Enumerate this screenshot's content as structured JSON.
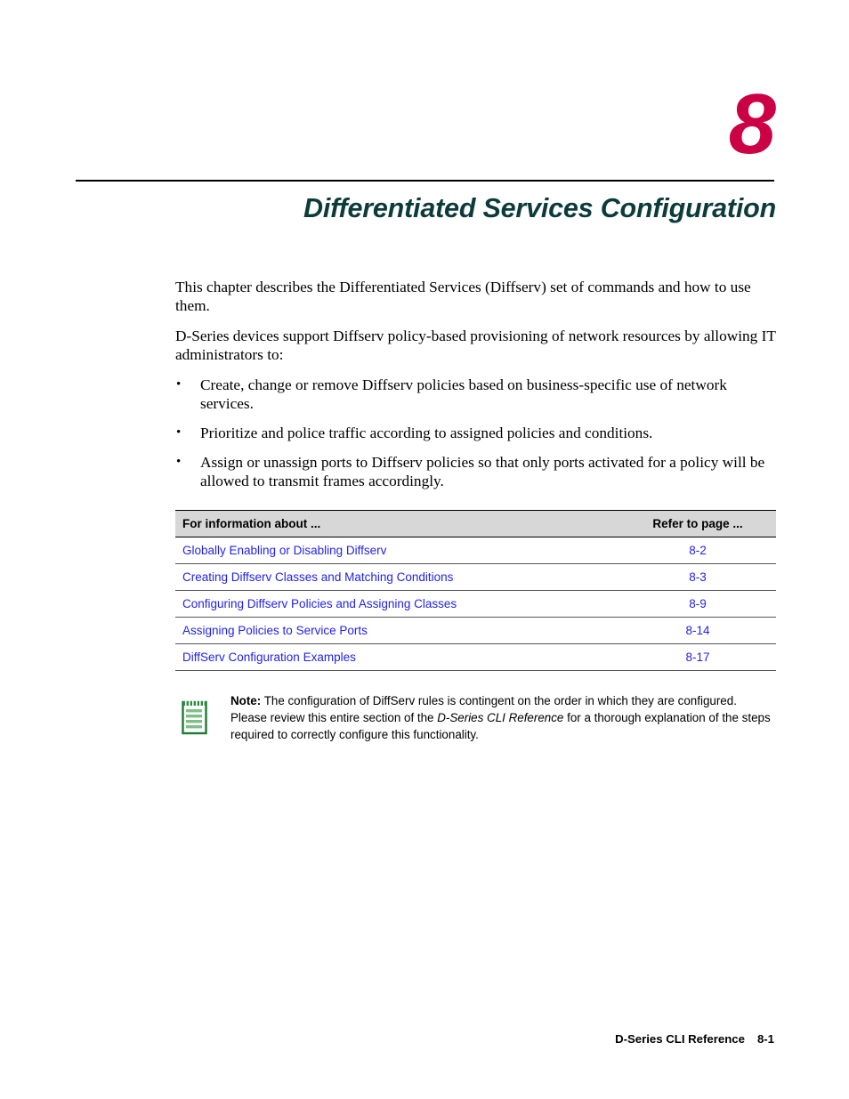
{
  "chapter": {
    "number": "8",
    "title": "Differentiated Services Configuration",
    "number_color": "#cc0044",
    "title_color": "#0d3b3b"
  },
  "intro": {
    "paragraph_1": "This chapter describes the Differentiated Services (Diffserv) set of commands and how to use them.",
    "paragraph_2": "D-Series devices support Diffserv policy-based provisioning of network resources by allowing IT administrators to:"
  },
  "bullets": [
    "Create, change or remove Diffserv policies based on business-specific use of network services.",
    "Prioritize and police traffic according to assigned policies and conditions.",
    "Assign or unassign ports to Diffserv policies so that only ports activated for a policy will be allowed to transmit frames accordingly."
  ],
  "ref_table": {
    "headers": [
      "For information about ...",
      "Refer to page ..."
    ],
    "link_color": "#2222ee",
    "header_bg": "#d7d7d7",
    "rows": [
      {
        "topic": "Globally Enabling or Disabling Diffserv",
        "page": "8-2"
      },
      {
        "topic": "Creating Diffserv Classes and Matching Conditions",
        "page": "8-3"
      },
      {
        "topic": "Configuring Diffserv Policies and Assigning Classes",
        "page": "8-9"
      },
      {
        "topic": "Assigning Policies to Service Ports",
        "page": "8-14"
      },
      {
        "topic": "DiffServ Configuration Examples",
        "page": "8-17"
      }
    ]
  },
  "note": {
    "icon": "notepad-icon",
    "icon_color": "#2e8b41",
    "label": "Note:",
    "text_part_1": " The configuration of DiffServ rules is contingent on the order in which they are configured. Please review this entire section of the ",
    "emphasis": "D-Series CLI Reference",
    "text_part_2": " for a thorough explanation of the steps required to correctly configure this functionality."
  },
  "footer": {
    "document": "D-Series CLI Reference",
    "page": "8-1"
  }
}
